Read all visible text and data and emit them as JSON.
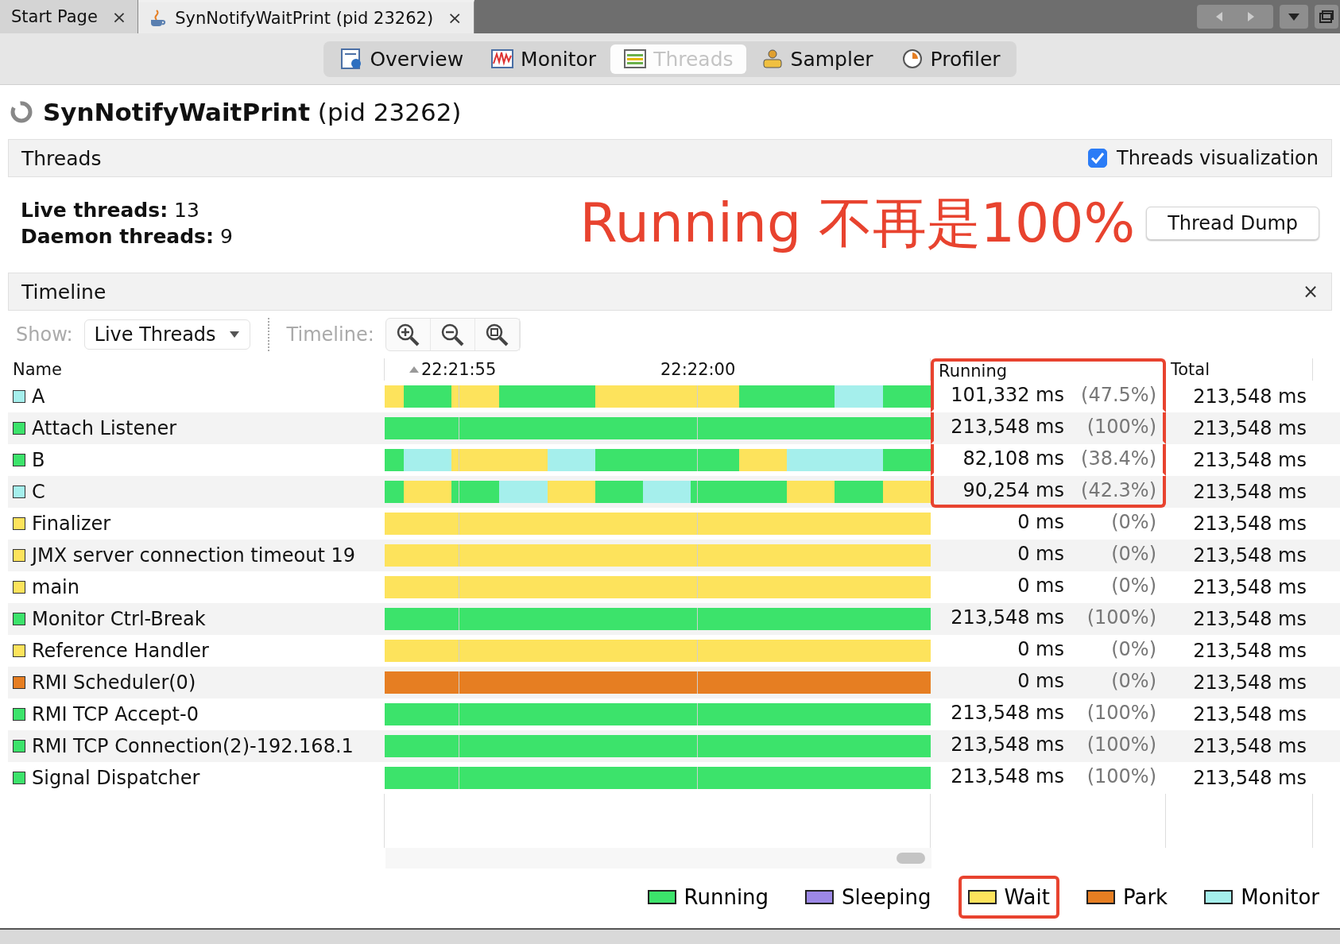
{
  "window_tabs": [
    {
      "label": "Start Page",
      "close": "×",
      "selected": false
    },
    {
      "label": "SynNotifyWaitPrint (pid 23262)",
      "close": "×",
      "selected": true
    }
  ],
  "view_tabs": [
    {
      "label": "Overview",
      "selected": false
    },
    {
      "label": "Monitor",
      "selected": false
    },
    {
      "label": "Threads",
      "selected": true
    },
    {
      "label": "Sampler",
      "selected": false
    },
    {
      "label": "Profiler",
      "selected": false
    }
  ],
  "title": "**SynNotifyWaitPrint** (pid 23262)",
  "threads_panel": {
    "title": "Threads",
    "visualization": {
      "label": "Threads visualization",
      "checked": true
    },
    "stats": [
      "**Live threads:** 13",
      "**Daemon threads:** 9"
    ],
    "dump_button": "Thread Dump"
  },
  "annotation": {
    "text": "Running 不再是100%"
  },
  "timeline": {
    "title": "Timeline",
    "close": "×",
    "show_label": "Show:",
    "show_value": "Live Threads",
    "timeline_label": "Timeline:",
    "columns": {
      "name": "Name",
      "times": [
        "22:21:55",
        "22:22:00"
      ],
      "running": {
        "label": "Running",
        "highlighted": true
      },
      "total": "Total"
    },
    "rows": [
      {
        "name": "A",
        "color": "#a5efec",
        "slices": [
          {
            "color": "#fde35c"
          },
          {
            "color": "#3ce36b"
          },
          {
            "color": "#fde35c"
          },
          {
            "color": "#3ce36b"
          },
          {
            "color": "#3ce36b"
          },
          {
            "color": "#fde35c"
          },
          {
            "color": "#fde35c"
          },
          {
            "color": "#fde35c"
          },
          {
            "color": "#3ce36b"
          },
          {
            "color": "#3ce36b"
          },
          {
            "color": "#a5efec"
          },
          {
            "color": "#3ce36b"
          }
        ],
        "running": "101,332 ms",
        "share": "(47.5%)",
        "total": "213,548 ms",
        "highlighted": true
      },
      {
        "name": "Attach Listener",
        "color": "#3ce36b",
        "slices": [
          {
            "color": "#3ce36b"
          }
        ],
        "running": "213,548 ms",
        "share": "(100%)",
        "total": "213,548 ms",
        "highlighted": true
      },
      {
        "name": "B",
        "color": "#3ce36b",
        "slices": [
          {
            "color": "#3ce36b"
          },
          {
            "color": "#a5efec"
          },
          {
            "color": "#fde35c"
          },
          {
            "color": "#fde35c"
          },
          {
            "color": "#a5efec"
          },
          {
            "color": "#3ce36b"
          },
          {
            "color": "#3ce36b"
          },
          {
            "color": "#3ce36b"
          },
          {
            "color": "#fde35c"
          },
          {
            "color": "#a5efec"
          },
          {
            "color": "#a5efec"
          },
          {
            "color": "#3ce36b"
          }
        ],
        "running": "82,108 ms",
        "share": "(38.4%)",
        "total": "213,548 ms",
        "highlighted": true
      },
      {
        "name": "C",
        "color": "#a5efec",
        "slices": [
          {
            "color": "#3ce36b"
          },
          {
            "color": "#fde35c"
          },
          {
            "color": "#3ce36b"
          },
          {
            "color": "#a5efec"
          },
          {
            "color": "#fde35c"
          },
          {
            "color": "#3ce36b"
          },
          {
            "color": "#a5efec"
          },
          {
            "color": "#3ce36b"
          },
          {
            "color": "#3ce36b"
          },
          {
            "color": "#fde35c"
          },
          {
            "color": "#3ce36b"
          },
          {
            "color": "#fde35c"
          }
        ],
        "running": "90,254 ms",
        "share": "(42.3%)",
        "total": "213,548 ms",
        "highlighted": true
      },
      {
        "name": "Finalizer",
        "color": "#fde35c",
        "slices": [
          {
            "color": "#fde35c"
          }
        ],
        "running": "0 ms",
        "share": "(0%)",
        "total": "213,548 ms",
        "highlighted": false
      },
      {
        "name": "JMX server connection timeout 19",
        "color": "#fde35c",
        "slices": [
          {
            "color": "#fde35c"
          }
        ],
        "running": "0 ms",
        "share": "(0%)",
        "total": "213,548 ms",
        "highlighted": false
      },
      {
        "name": "main",
        "color": "#fde35c",
        "slices": [
          {
            "color": "#fde35c"
          }
        ],
        "running": "0 ms",
        "share": "(0%)",
        "total": "213,548 ms",
        "highlighted": false
      },
      {
        "name": "Monitor Ctrl-Break",
        "color": "#3ce36b",
        "slices": [
          {
            "color": "#3ce36b"
          }
        ],
        "running": "213,548 ms",
        "share": "(100%)",
        "total": "213,548 ms",
        "highlighted": false
      },
      {
        "name": "Reference Handler",
        "color": "#fde35c",
        "slices": [
          {
            "color": "#fde35c"
          }
        ],
        "running": "0 ms",
        "share": "(0%)",
        "total": "213,548 ms",
        "highlighted": false
      },
      {
        "name": "RMI Scheduler(0)",
        "color": "#e67e22",
        "slices": [
          {
            "color": "#e67e22"
          }
        ],
        "running": "0 ms",
        "share": "(0%)",
        "total": "213,548 ms",
        "highlighted": false
      },
      {
        "name": "RMI TCP Accept-0",
        "color": "#3ce36b",
        "slices": [
          {
            "color": "#3ce36b"
          }
        ],
        "running": "213,548 ms",
        "share": "(100%)",
        "total": "213,548 ms",
        "highlighted": false
      },
      {
        "name": "RMI TCP Connection(2)-192.168.1",
        "color": "#3ce36b",
        "slices": [
          {
            "color": "#3ce36b"
          }
        ],
        "running": "213,548 ms",
        "share": "(100%)",
        "total": "213,548 ms",
        "highlighted": false
      },
      {
        "name": "Signal Dispatcher",
        "color": "#3ce36b",
        "slices": [
          {
            "color": "#3ce36b"
          }
        ],
        "running": "213,548 ms",
        "share": "(100%)",
        "total": "213,548 ms",
        "highlighted": false
      }
    ],
    "legend": [
      {
        "label": "Running",
        "color": "#3ce36b",
        "highlighted": false
      },
      {
        "label": "Sleeping",
        "color": "#9c88e6",
        "highlighted": false
      },
      {
        "label": "Wait",
        "color": "#fde35c",
        "highlighted": true
      },
      {
        "label": "Park",
        "color": "#e67e22",
        "highlighted": false
      },
      {
        "label": "Monitor",
        "color": "#a5efec",
        "highlighted": false
      }
    ]
  }
}
